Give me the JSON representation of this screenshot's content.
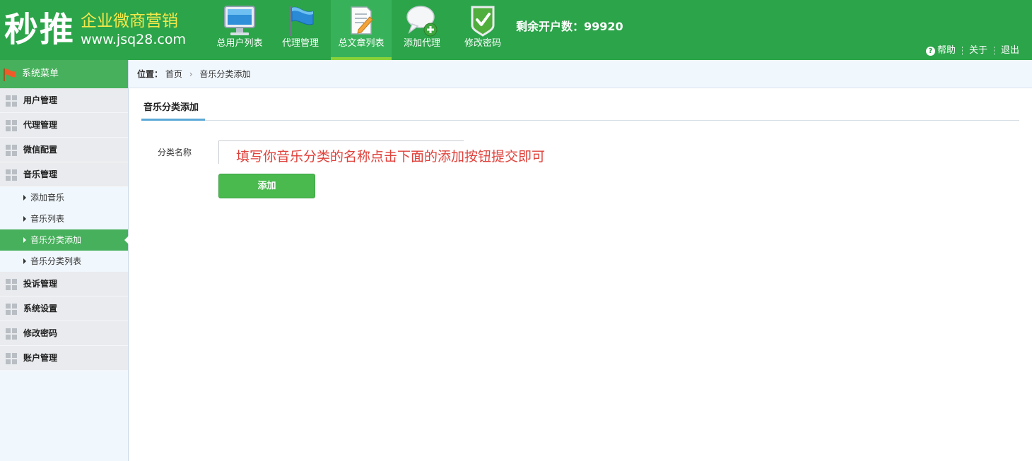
{
  "header": {
    "logo_main": "秒推",
    "logo_sub": "企业微商营销",
    "logo_url": "www.jsq28.com",
    "nav": [
      {
        "label": "总用户列表",
        "icon": "monitor-icon"
      },
      {
        "label": "代理管理",
        "icon": "flag-icon"
      },
      {
        "label": "总文章列表",
        "icon": "document-edit-icon"
      },
      {
        "label": "添加代理",
        "icon": "chat-add-icon"
      },
      {
        "label": "修改密码",
        "icon": "shield-check-icon"
      }
    ],
    "active_nav": "总文章列表",
    "remaining": "剩余开户数：99920",
    "links": {
      "help": "帮助",
      "about": "关于",
      "logout": "退出"
    }
  },
  "sidebar": {
    "title": "系统菜单",
    "groups": [
      {
        "label": "用户管理"
      },
      {
        "label": "代理管理"
      },
      {
        "label": "微信配置"
      },
      {
        "label": "音乐管理"
      },
      {
        "label": "投诉管理"
      },
      {
        "label": "系统设置"
      },
      {
        "label": "修改密码"
      },
      {
        "label": "账户管理"
      }
    ],
    "music_subitems": [
      {
        "label": "添加音乐"
      },
      {
        "label": "音乐列表"
      },
      {
        "label": "音乐分类添加"
      },
      {
        "label": "音乐分类列表"
      }
    ],
    "active_subitem": "音乐分类添加"
  },
  "breadcrumb": {
    "prefix": "位置：",
    "home": "首页",
    "current": "音乐分类添加"
  },
  "main": {
    "tab": "音乐分类添加",
    "form": {
      "label": "分类名称",
      "value": "",
      "hint": "填写你音乐分类的名称点击下面的添加按钮提交即可",
      "submit": "添加"
    }
  },
  "colors": {
    "header_green": "#2ca44a",
    "sidebar_active": "#47b05c",
    "button_green": "#4aba4f",
    "hint_red": "#e0413b",
    "logo_yellow": "#f4e94b"
  }
}
